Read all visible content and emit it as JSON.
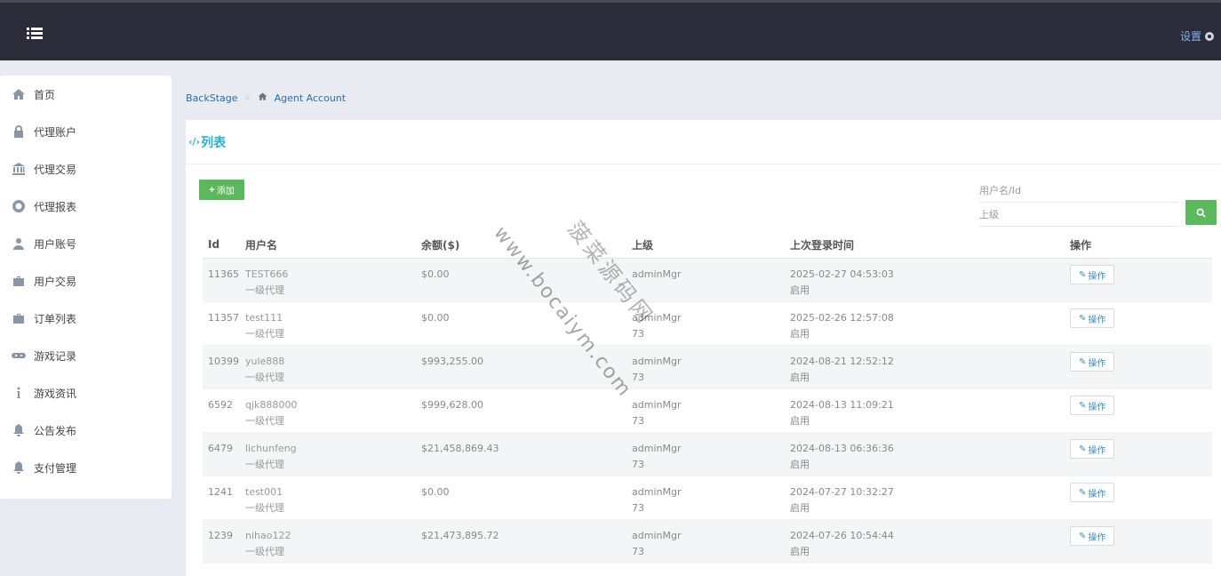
{
  "topbar": {
    "settings_label": "设置"
  },
  "sidebar": {
    "items": [
      {
        "label": "首页",
        "icon": "home-icon"
      },
      {
        "label": "代理账户",
        "icon": "lock-icon"
      },
      {
        "label": "代理交易",
        "icon": "bank-icon"
      },
      {
        "label": "代理报表",
        "icon": "lifebuoy-icon"
      },
      {
        "label": "用户账号",
        "icon": "user-icon"
      },
      {
        "label": "用户交易",
        "icon": "briefcase-icon"
      },
      {
        "label": "订单列表",
        "icon": "briefcase-icon"
      },
      {
        "label": "游戏记录",
        "icon": "gamepad-icon"
      },
      {
        "label": "游戏资讯",
        "icon": "info-icon"
      },
      {
        "label": "公告发布",
        "icon": "bell-icon"
      },
      {
        "label": "支付管理",
        "icon": "bell-icon"
      }
    ]
  },
  "breadcrumb": {
    "root": "BackStage",
    "current": "Agent Account"
  },
  "panel": {
    "title": "列表",
    "code_glyph": "‹/›"
  },
  "toolbar": {
    "add_label": "添加"
  },
  "filters": {
    "username_placeholder": "用户名/Id",
    "parent_placeholder": "上级"
  },
  "table": {
    "headers": [
      "Id",
      "用户名",
      "余额($)",
      "上级",
      "上次登录时间",
      "操作"
    ],
    "op_label": "操作",
    "rows": [
      {
        "id": "11365",
        "name": "TEST666",
        "level": "一级代理",
        "balance": "$0.00",
        "parent": "adminMgr",
        "parent_id": "",
        "last_login": "2025-02-27 04:53:03",
        "status": "启用"
      },
      {
        "id": "11357",
        "name": "test111",
        "level": "一级代理",
        "balance": "$0.00",
        "parent": "adminMgr",
        "parent_id": "73",
        "last_login": "2025-02-26 12:57:08",
        "status": "启用"
      },
      {
        "id": "10399",
        "name": "yule888",
        "level": "一级代理",
        "balance": "$993,255.00",
        "parent": "adminMgr",
        "parent_id": "73",
        "last_login": "2024-08-21 12:52:12",
        "status": "启用"
      },
      {
        "id": "6592",
        "name": "qjk888000",
        "level": "一级代理",
        "balance": "$999,628.00",
        "parent": "adminMgr",
        "parent_id": "73",
        "last_login": "2024-08-13 11:09:21",
        "status": "启用"
      },
      {
        "id": "6479",
        "name": "lichunfeng",
        "level": "一级代理",
        "balance": "$21,458,869.43",
        "parent": "adminMgr",
        "parent_id": "73",
        "last_login": "2024-08-13 06:36:36",
        "status": "启用"
      },
      {
        "id": "1241",
        "name": "test001",
        "level": "一级代理",
        "balance": "$0.00",
        "parent": "adminMgr",
        "parent_id": "73",
        "last_login": "2024-07-27 10:32:27",
        "status": "启用"
      },
      {
        "id": "1239",
        "name": "nihao122",
        "level": "一级代理",
        "balance": "$21,473,895.72",
        "parent": "adminMgr",
        "parent_id": "73",
        "last_login": "2024-07-26 10:54:44",
        "status": "启用"
      }
    ]
  },
  "watermark": {
    "url": "www.bocaiym.com",
    "brand": "菠菜源码网"
  },
  "colors": {
    "topbar": "#2b2b3a",
    "accent": "#27b0c9",
    "green": "#5cb85c",
    "link": "#3c8dbc"
  }
}
